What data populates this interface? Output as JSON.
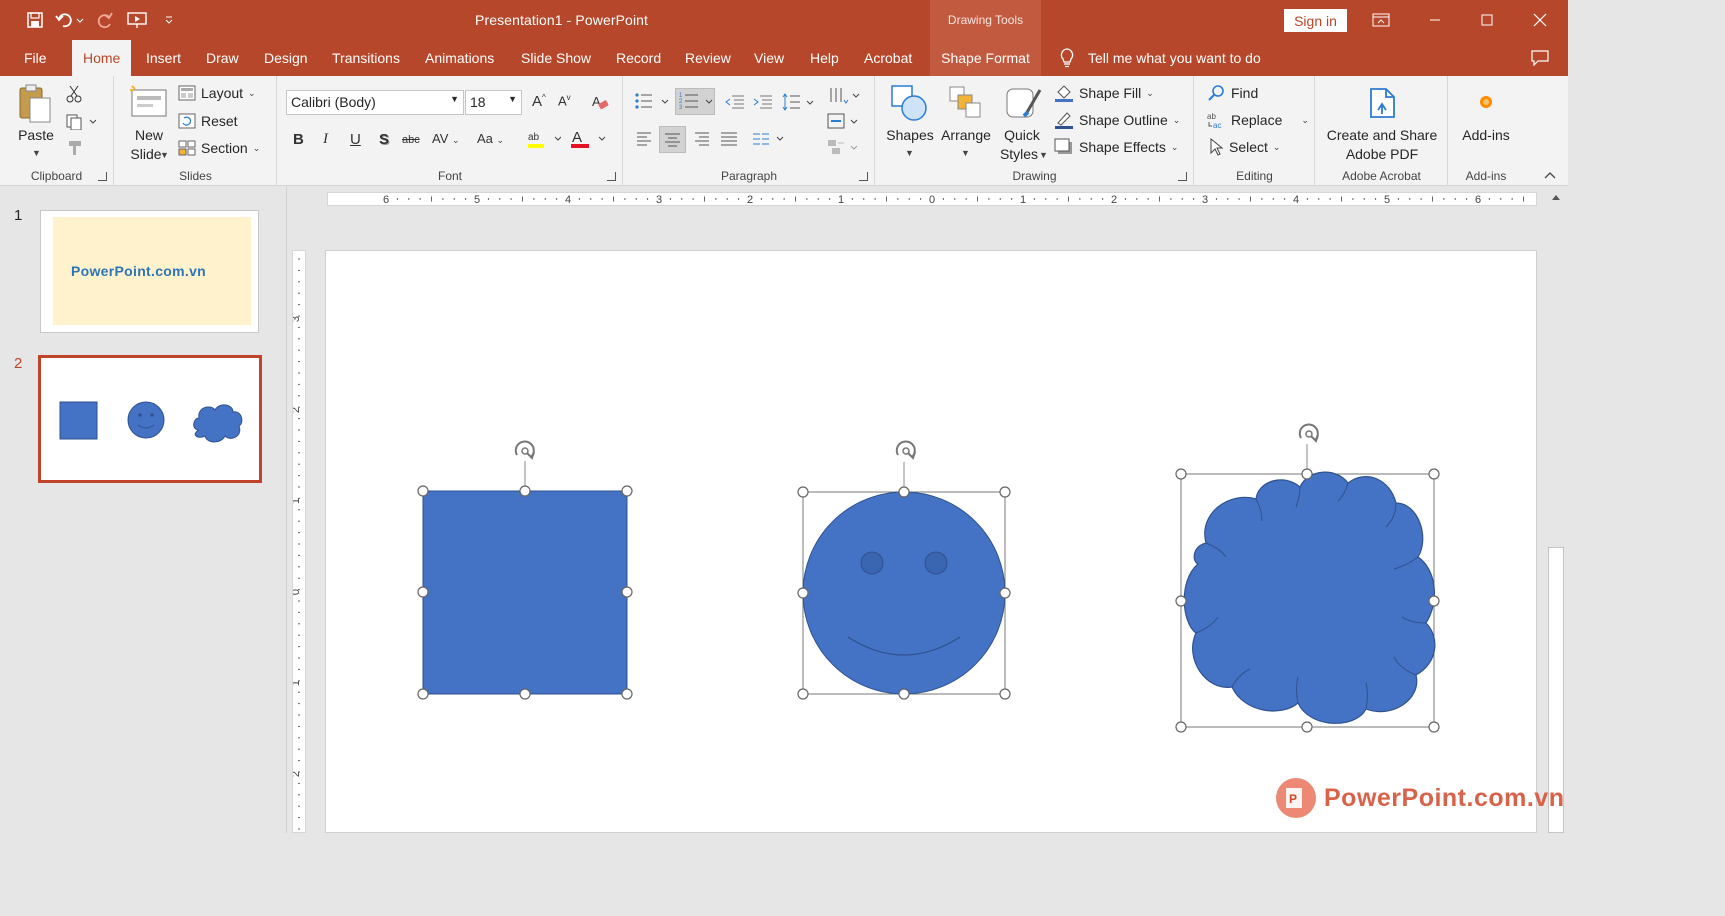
{
  "titlebar": {
    "title": "Presentation1  -  PowerPoint",
    "contextual": "Drawing Tools",
    "sign_in": "Sign in"
  },
  "tabs": [
    "File",
    "Home",
    "Insert",
    "Draw",
    "Design",
    "Transitions",
    "Animations",
    "Slide Show",
    "Record",
    "Review",
    "View",
    "Help",
    "Acrobat",
    "Shape Format"
  ],
  "tell_me": "Tell me what you want to do",
  "ribbon": {
    "clipboard": {
      "paste": "Paste",
      "label": "Clipboard"
    },
    "slides": {
      "new_slide_1": "New",
      "new_slide_2": "Slide",
      "layout": "Layout",
      "reset": "Reset",
      "section": "Section",
      "label": "Slides"
    },
    "font": {
      "name": "Calibri (Body)",
      "size": "18",
      "label": "Font",
      "bold": "B",
      "italic": "I",
      "underline": "U",
      "shadow": "S",
      "strike": "abc",
      "spacing": "AV",
      "case": "Aa",
      "grow": "A",
      "shrink": "A"
    },
    "paragraph": {
      "label": "Paragraph"
    },
    "drawing": {
      "shapes": "Shapes",
      "arrange": "Arrange",
      "quick_1": "Quick",
      "quick_2": "Styles",
      "fill": "Shape Fill",
      "outline": "Shape Outline",
      "effects": "Shape Effects",
      "label": "Drawing"
    },
    "editing": {
      "find": "Find",
      "replace": "Replace",
      "select": "Select",
      "label": "Editing"
    },
    "acrobat": {
      "line1": "Create and Share",
      "line2": "Adobe PDF",
      "label": "Adobe Acrobat"
    },
    "addins": {
      "button": "Add-ins",
      "label": "Add-ins"
    }
  },
  "thumbnails": [
    {
      "number": "1",
      "logo_text": "PowerPoint.com.vn"
    },
    {
      "number": "2"
    }
  ],
  "rulers": {
    "horizontal": [
      "6",
      "5",
      "4",
      "3",
      "2",
      "1",
      "0",
      "1",
      "2",
      "3",
      "4",
      "5",
      "6"
    ],
    "vertical": [
      "3",
      "2",
      "1",
      "0",
      "1",
      "2"
    ]
  },
  "slide_shapes": [
    "rectangle",
    "smiley-face",
    "cloud"
  ],
  "watermark": "PowerPoint.com.vn",
  "colors": {
    "accent": "#b7472a",
    "shape_fill": "#4472c4",
    "shape_outline": "#2f528f"
  }
}
